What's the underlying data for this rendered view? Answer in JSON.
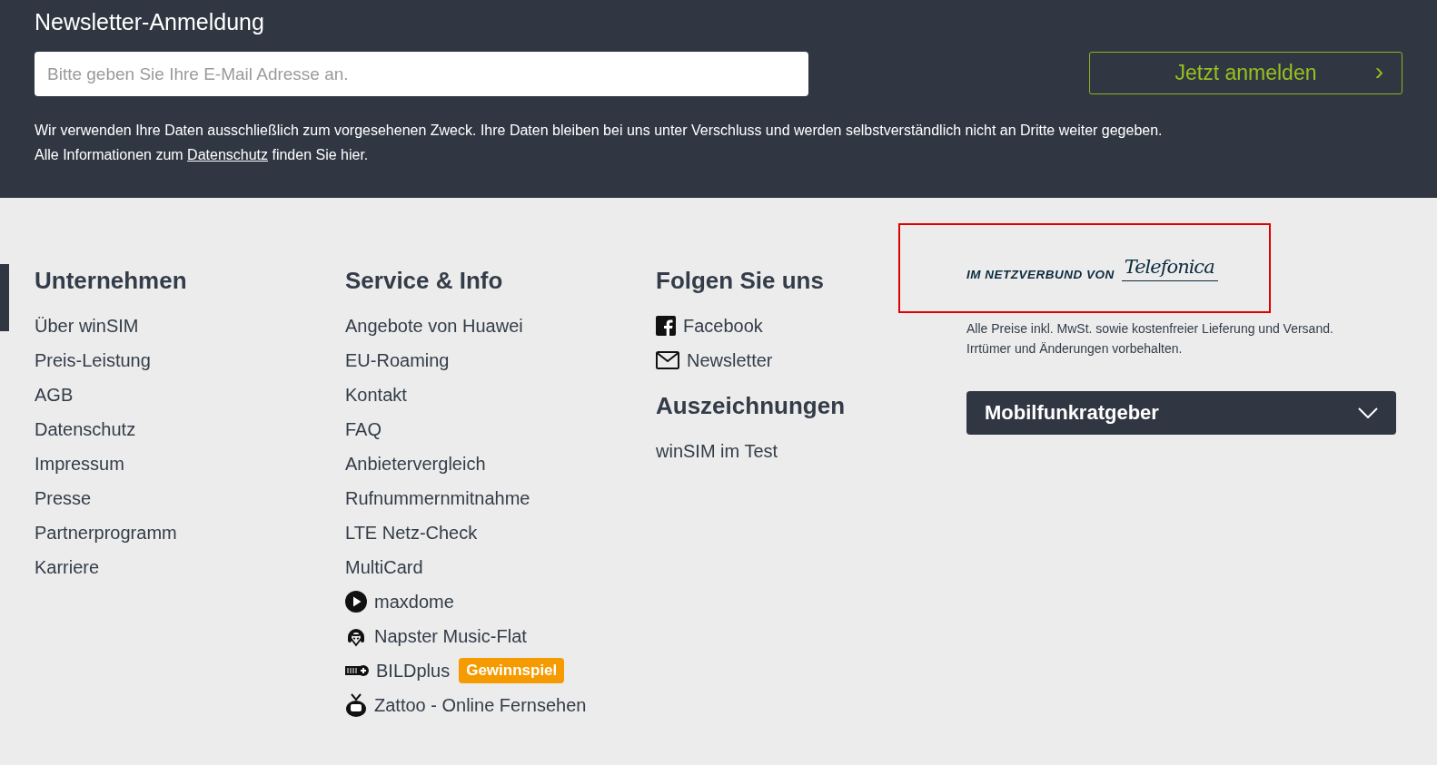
{
  "newsletter": {
    "title": "Newsletter-Anmeldung",
    "email_field": {
      "placeholder": "Bitte geben Sie Ihre E-Mail Adresse an."
    },
    "submit_button": {
      "label": "Jetzt anmelden",
      "icon": "›"
    },
    "privacy_text": "Wir verwenden Ihre Daten ausschließlich zum vorgesehenen Zweck. Ihre Daten bleiben bei uns unter Verschluss und werden selbstverständlich nicht an Dritte weiter gegeben.",
    "privacy_line2": {
      "before": "Alle Informationen zum ",
      "link": "Datenschutz",
      "after": " finden Sie hier."
    }
  },
  "columns": [
    {
      "heading": "Unternehmen",
      "links": [
        {
          "label": "Über winSIM",
          "kind": "plain"
        },
        {
          "label": "Preis-Leistung",
          "kind": "plain"
        },
        {
          "label": "AGB",
          "kind": "plain"
        },
        {
          "label": "Datenschutz",
          "kind": "plain"
        },
        {
          "label": "Impressum",
          "kind": "plain"
        },
        {
          "label": "Presse",
          "kind": "plain"
        },
        {
          "label": "Partnerprogramm",
          "kind": "plain"
        },
        {
          "label": "Karriere",
          "kind": "plain"
        }
      ]
    },
    {
      "heading": "Service & Info",
      "links": [
        {
          "label": "Angebote von Huawei",
          "kind": "plain"
        },
        {
          "label": "EU-Roaming",
          "kind": "plain"
        },
        {
          "label": "Kontakt",
          "kind": "plain"
        },
        {
          "label": "FAQ",
          "kind": "plain"
        },
        {
          "label": "Anbietervergleich",
          "kind": "plain"
        },
        {
          "label": "Rufnummernmitnahme",
          "kind": "plain"
        },
        {
          "label": "LTE Netz-Check",
          "kind": "plain"
        },
        {
          "label": "MultiCard",
          "kind": "plain"
        },
        {
          "label": "maxdome",
          "kind": "play"
        },
        {
          "label": "Napster Music-Flat",
          "kind": "cat"
        },
        {
          "label": "BILDplus",
          "kind": "bild",
          "badge": "Gewinnspiel"
        },
        {
          "label": "Zattoo - Online Fernsehen",
          "kind": "tv"
        }
      ]
    },
    {
      "heading": "Folgen Sie uns",
      "links": [
        {
          "label": "Facebook",
          "kind": "facebook"
        },
        {
          "label": "Newsletter",
          "kind": "mail"
        }
      ],
      "heading2": "Auszeichnungen",
      "links2": [
        {
          "label": "winSIM im Test",
          "kind": "plain"
        }
      ]
    }
  ],
  "network_logo": {
    "prefix": "IM NETZVERBUND VON",
    "brand": "Telefonica"
  },
  "price_note": [
    "Alle Preise inkl. MwSt. sowie kostenfreier Lieferung und Versand.",
    "Irrtümer und Änderungen vorbehalten."
  ],
  "accordion": {
    "label": "Mobilfunkratgeber",
    "expanded": false
  }
}
